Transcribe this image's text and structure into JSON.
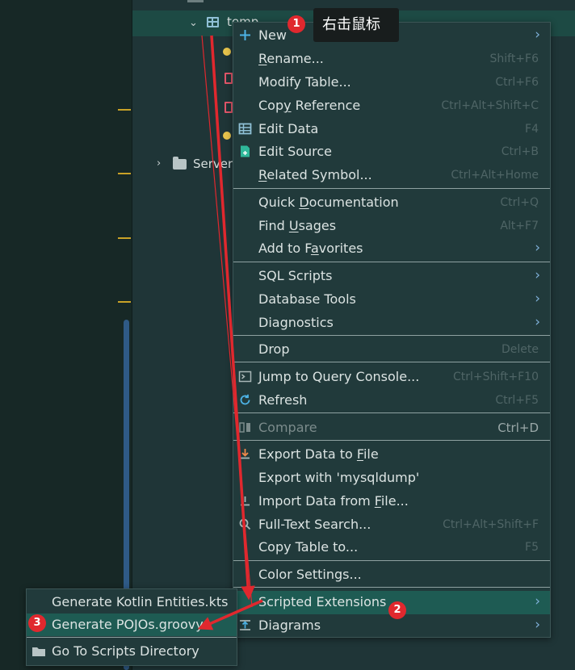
{
  "tree": {
    "table_name": "temp",
    "folder_label": "Server"
  },
  "menu": {
    "items": [
      {
        "label": "New",
        "shortcut": "",
        "arrow": "›",
        "icon": "plus-icon"
      },
      {
        "label": "Rename...",
        "shortcut": "Shift+F6",
        "arrow": "",
        "icon": ""
      },
      {
        "label": "Modify Table...",
        "shortcut": "Ctrl+F6",
        "arrow": "",
        "icon": ""
      },
      {
        "label": "Copy Reference",
        "shortcut": "Ctrl+Alt+Shift+C",
        "arrow": "",
        "icon": ""
      },
      {
        "label": "Edit Data",
        "shortcut": "F4",
        "arrow": "",
        "icon": "table-grid-icon"
      },
      {
        "label": "Edit Source",
        "shortcut": "Ctrl+B",
        "arrow": "",
        "icon": "edit-source-icon"
      },
      {
        "label": "Related Symbol...",
        "shortcut": "Ctrl+Alt+Home",
        "arrow": "",
        "icon": ""
      },
      {
        "label": "Quick Documentation",
        "shortcut": "Ctrl+Q",
        "arrow": "",
        "icon": ""
      },
      {
        "label": "Find Usages",
        "shortcut": "Alt+F7",
        "arrow": "",
        "icon": ""
      },
      {
        "label": "Add to Favorites",
        "shortcut": "",
        "arrow": "›",
        "icon": ""
      },
      {
        "label": "SQL Scripts",
        "shortcut": "",
        "arrow": "›",
        "icon": ""
      },
      {
        "label": "Database Tools",
        "shortcut": "",
        "arrow": "›",
        "icon": ""
      },
      {
        "label": "Diagnostics",
        "shortcut": "",
        "arrow": "›",
        "icon": ""
      },
      {
        "label": "Drop",
        "shortcut": "Delete",
        "arrow": "",
        "icon": ""
      },
      {
        "label": "Jump to Query Console...",
        "shortcut": "Ctrl+Shift+F10",
        "arrow": "",
        "icon": "console-icon"
      },
      {
        "label": "Refresh",
        "shortcut": "Ctrl+F5",
        "arrow": "",
        "icon": "refresh-icon"
      },
      {
        "label": "Compare",
        "shortcut": "Ctrl+D",
        "arrow": "",
        "icon": "compare-icon"
      },
      {
        "label": "Export Data to File",
        "shortcut": "",
        "arrow": "",
        "icon": "export-icon"
      },
      {
        "label": "Export with 'mysqldump'",
        "shortcut": "",
        "arrow": "",
        "icon": ""
      },
      {
        "label": "Import Data from File...",
        "shortcut": "",
        "arrow": "",
        "icon": "import-icon"
      },
      {
        "label": "Full-Text Search...",
        "shortcut": "Ctrl+Alt+Shift+F",
        "arrow": "",
        "icon": "search-icon"
      },
      {
        "label": "Copy Table to...",
        "shortcut": "F5",
        "arrow": "",
        "icon": ""
      },
      {
        "label": "Color Settings...",
        "shortcut": "",
        "arrow": "",
        "icon": ""
      },
      {
        "label": "Scripted Extensions",
        "shortcut": "",
        "arrow": "›",
        "icon": ""
      },
      {
        "label": "Diagrams",
        "shortcut": "",
        "arrow": "›",
        "icon": "diagram-icon"
      }
    ]
  },
  "submenu": {
    "items": [
      {
        "label": "Generate Kotlin Entities.kts"
      },
      {
        "label": "Generate POJOs.groovy"
      },
      {
        "label": "Go To Scripts Directory"
      }
    ]
  },
  "annotations": {
    "step1": "1",
    "step2": "2",
    "step3": "3",
    "tooltip": "右击鼠标",
    "arrow_color": "#e0282e"
  },
  "colors": {
    "menu_bg": "#213a3b",
    "highlight": "#1e5b53",
    "accent_blue": "#7fb0d8"
  }
}
